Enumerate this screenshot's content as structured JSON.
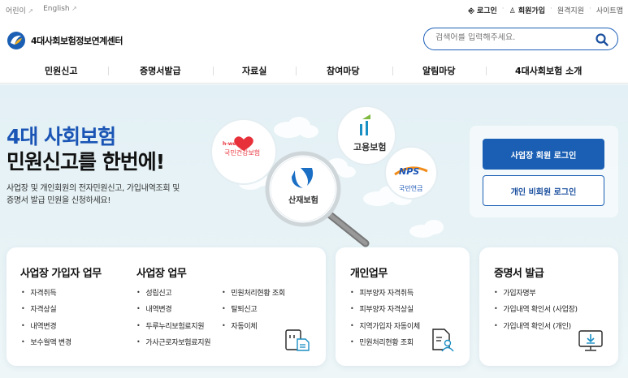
{
  "util": {
    "kids": "어린이",
    "english": "English",
    "login": "로그인",
    "signup": "회원가입",
    "remote": "원격지원",
    "sitemap": "사이트맵"
  },
  "header": {
    "logo_text": "4대사회보험정보연계센터",
    "search_placeholder": "검색어를 입력해주세요."
  },
  "nav": {
    "items": [
      "민원신고",
      "증명서발급",
      "자료실",
      "참여마당",
      "알림마당",
      "4대사회보험 소개"
    ]
  },
  "hero": {
    "title_line1": "4대 사회보험",
    "title_line2": "민원신고를 한번에!",
    "desc_line1": "사업장 및 개인회원의 전자민원신고, 가입내역조회 및",
    "desc_line2": "증명서 발급 민원을 신청하세요!",
    "badges": {
      "health_brand": "h-well",
      "health": "국민건강보험",
      "employment": "고용보험",
      "pension_brand": "NPS",
      "pension": "국민연금",
      "industrial": "산재보험"
    }
  },
  "login": {
    "business": "사업장 회원 로그인",
    "individual": "개인 비회원 로그인"
  },
  "cards": {
    "employer": {
      "title": "사업장 가입자 업무",
      "items": [
        "자격취득",
        "자격상실",
        "내역변경",
        "보수월액 변경"
      ]
    },
    "business": {
      "title": "사업장 업무",
      "col1": [
        "성립신고",
        "내역변경",
        "두루누리보험료지원",
        "가사근로자보험료지원"
      ],
      "col2": [
        "민원처리현황 조회",
        "탈퇴신고",
        "자동이체"
      ]
    },
    "personal": {
      "title": "개인업무",
      "items": [
        "피부양자 자격취득",
        "피부양자 자격상실",
        "지역가입자 자동이체",
        "민원처리현황 조회"
      ]
    },
    "certificate": {
      "title": "증명서 발급",
      "items": [
        "가입자명부",
        "가입내역 확인서 (사업장)",
        "가입내역 확인서 (개인)"
      ]
    }
  },
  "colors": {
    "primary": "#1a5fb4",
    "hero_bg": "#e3f0f5",
    "health_red": "#e8303a",
    "pension_orange": "#f08c1a",
    "industrial_blue": "#1a6fc4"
  }
}
